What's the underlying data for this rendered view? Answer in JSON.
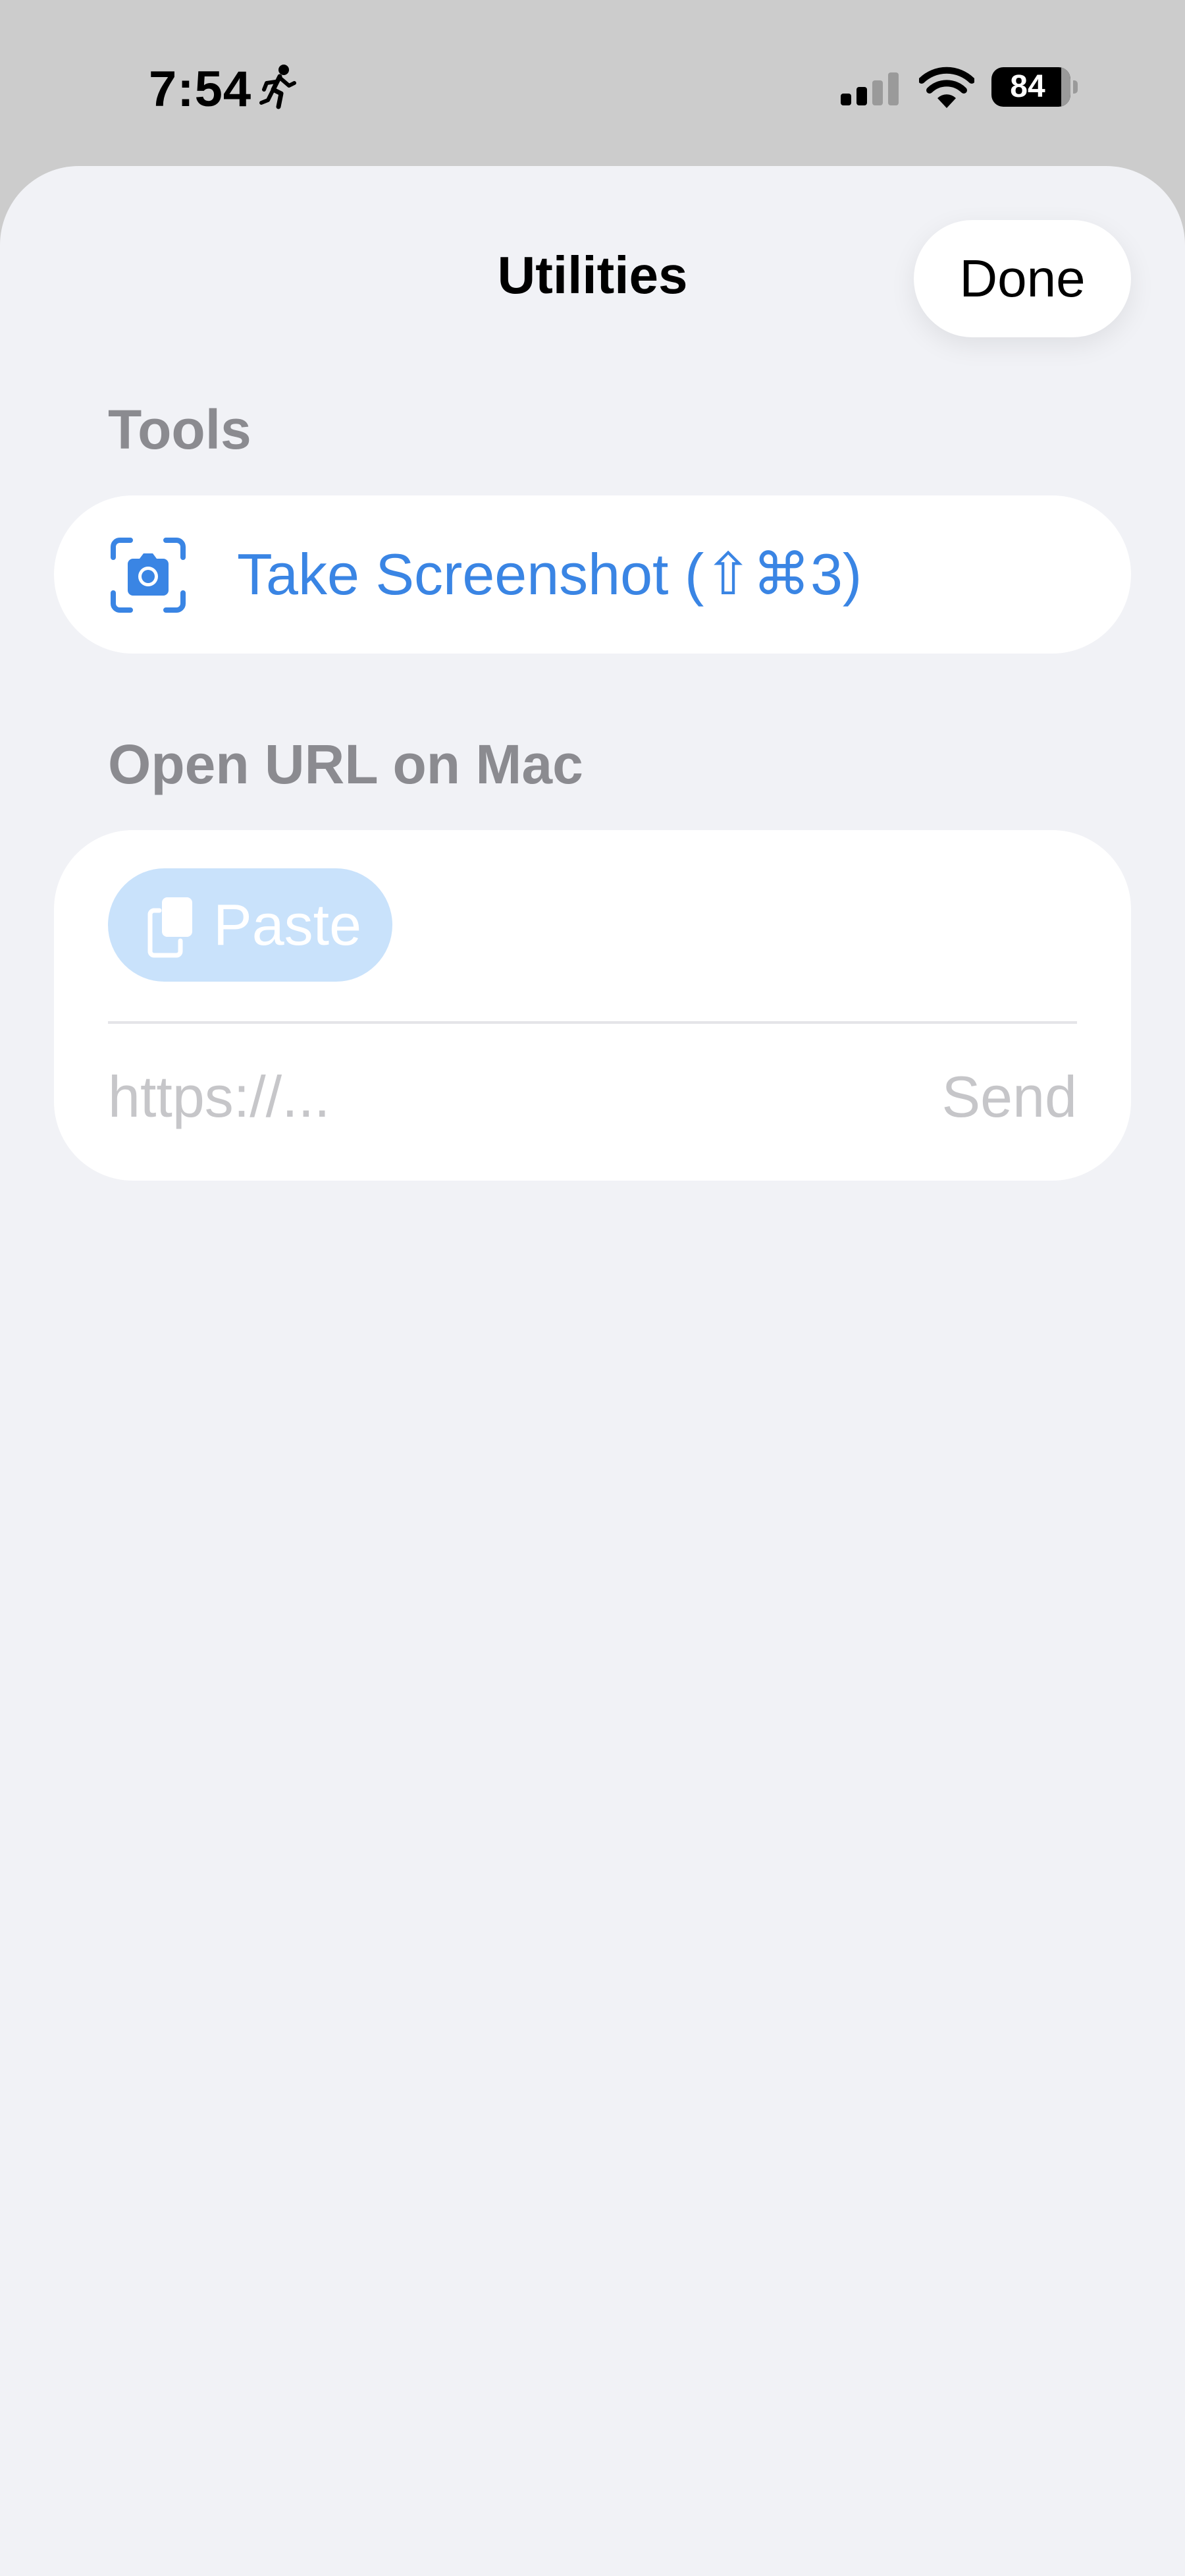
{
  "status_bar": {
    "time": "7:54",
    "battery_level": "84",
    "icons": [
      "activity-figure-icon",
      "cellular-signal-icon",
      "wifi-icon",
      "battery-icon"
    ]
  },
  "sheet": {
    "title": "Utilities",
    "done_label": "Done"
  },
  "tools": {
    "header": "Tools",
    "screenshot_label": "Take Screenshot (⇧⌘3)",
    "screenshot_icon": "camera-viewfinder-icon"
  },
  "open_url": {
    "header": "Open URL on Mac",
    "paste_label": "Paste",
    "paste_icon": "clipboard-icon",
    "url_value": "",
    "url_placeholder": "https://...",
    "send_label": "Send"
  },
  "colors": {
    "accent": "#3a85e4",
    "paste_disabled_bg": "#c9e2fb",
    "sheet_bg": "#f1f2f6",
    "section_header": "#8b8b90",
    "placeholder": "#c6c6c9"
  }
}
